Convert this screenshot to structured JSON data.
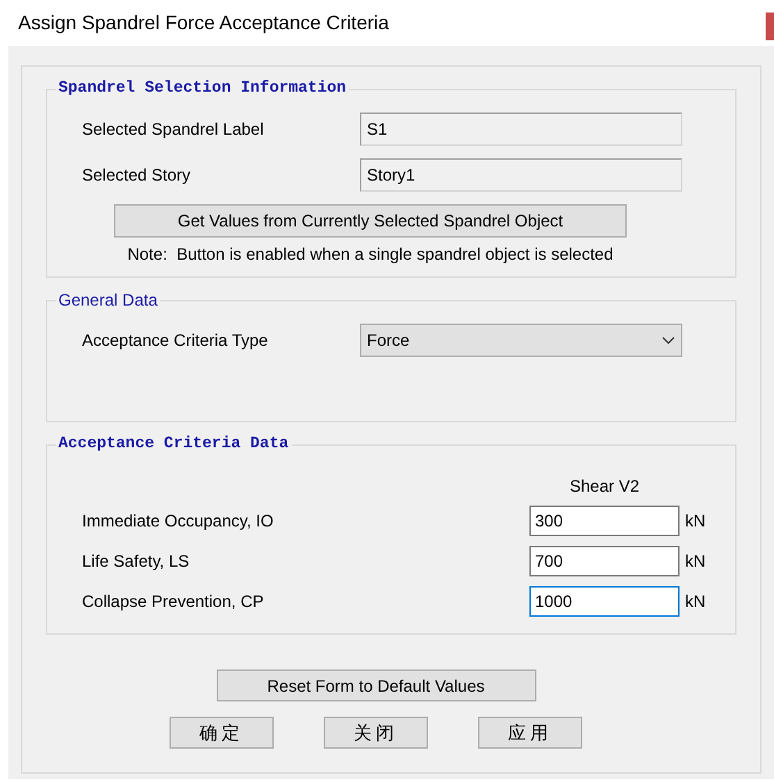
{
  "window": {
    "title": "Assign Spandrel Force Acceptance Criteria"
  },
  "selection": {
    "heading": "Spandrel Selection Information",
    "fields": [
      {
        "label": "Selected Spandrel Label",
        "value": "S1"
      },
      {
        "label": "Selected Story",
        "value": "Story1"
      }
    ],
    "button": "Get Values from Currently Selected Spandrel Object",
    "note": "Note:  Button is enabled when a single spandrel object is selected"
  },
  "general": {
    "heading": "General Data",
    "label": "Acceptance Criteria Type",
    "value": "Force"
  },
  "criteria": {
    "heading": "Acceptance Criteria Data",
    "column": "Shear V2",
    "rows": [
      {
        "label": "Immediate Occupancy, IO",
        "value": "300",
        "unit": "kN",
        "focused": false
      },
      {
        "label": "Life Safety, LS",
        "value": "700",
        "unit": "kN",
        "focused": false
      },
      {
        "label": "Collapse Prevention, CP",
        "value": "1000",
        "unit": "kN",
        "focused": true
      }
    ]
  },
  "reset_button": "Reset Form to Default Values",
  "buttons": [
    "确定",
    "关闭",
    "应用"
  ]
}
